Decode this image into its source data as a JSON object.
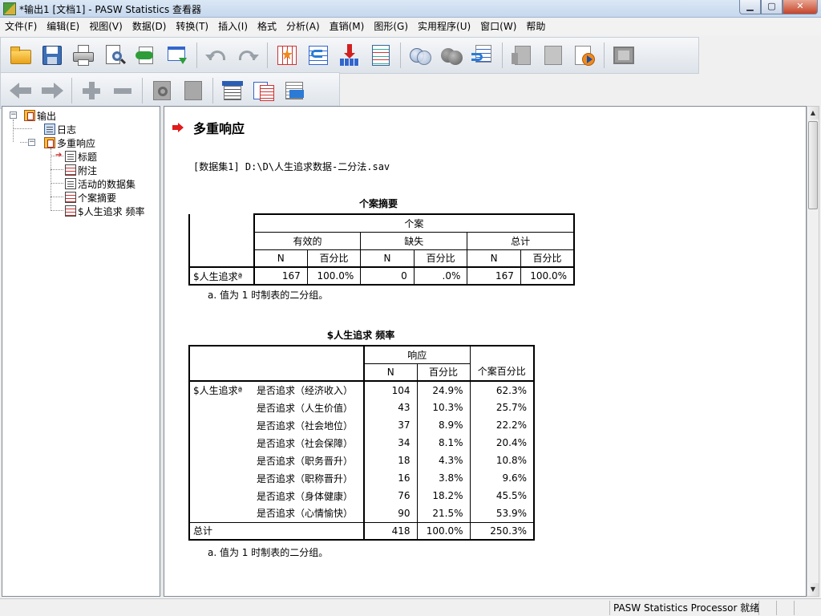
{
  "window": {
    "title": "*输出1 [文档1] - PASW Statistics 查看器",
    "min_label": "▁",
    "max_label": "▢",
    "close_label": "✕"
  },
  "menu": [
    {
      "label": "文件(F)"
    },
    {
      "label": "编辑(E)"
    },
    {
      "label": "视图(V)"
    },
    {
      "label": "数据(D)"
    },
    {
      "label": "转换(T)"
    },
    {
      "label": "插入(I)"
    },
    {
      "label": "格式"
    },
    {
      "label": "分析(A)"
    },
    {
      "label": "直销(M)"
    },
    {
      "label": "图形(G)"
    },
    {
      "label": "实用程序(U)"
    },
    {
      "label": "窗口(W)"
    },
    {
      "label": "帮助"
    }
  ],
  "tree": {
    "root": "输出",
    "log": "日志",
    "multi": "多重响应",
    "title": "标题",
    "notes": "附注",
    "active_dataset": "活动的数据集",
    "case_summary": "个案摘要",
    "freq": "$人生追求 频率"
  },
  "section": {
    "title": "多重响应",
    "dataset": "[数据集1] D:\\D\\人生追求数据-二分法.sav"
  },
  "case_summary_table": {
    "title": "个案摘要",
    "group_header": "个案",
    "sub_headers": [
      "有效的",
      "缺失",
      "总计"
    ],
    "col_headers": [
      "N",
      "百分比",
      "N",
      "百分比",
      "N",
      "百分比"
    ],
    "row_label": "$人生追求ª",
    "values": [
      "167",
      "100.0%",
      "0",
      ".0%",
      "167",
      "100.0%"
    ],
    "footnote": "a. 值为 1 时制表的二分组。"
  },
  "freq_table": {
    "title": "$人生追求 频率",
    "group_header": "响应",
    "col_headers": [
      "N",
      "百分比"
    ],
    "case_pct_header": "个案百分比",
    "var_label": "$人生追求ª",
    "rows": [
      {
        "label": "是否追求（经济收入）",
        "n": "104",
        "pct": "24.9%",
        "case": "62.3%"
      },
      {
        "label": "是否追求（人生价值）",
        "n": "43",
        "pct": "10.3%",
        "case": "25.7%"
      },
      {
        "label": "是否追求（社会地位）",
        "n": "37",
        "pct": "8.9%",
        "case": "22.2%"
      },
      {
        "label": "是否追求（社会保障）",
        "n": "34",
        "pct": "8.1%",
        "case": "20.4%"
      },
      {
        "label": "是否追求（职务晋升）",
        "n": "18",
        "pct": "4.3%",
        "case": "10.8%"
      },
      {
        "label": "是否追求（职称晋升）",
        "n": "16",
        "pct": "3.8%",
        "case": "9.6%"
      },
      {
        "label": "是否追求（身体健康）",
        "n": "76",
        "pct": "18.2%",
        "case": "45.5%"
      },
      {
        "label": "是否追求（心情愉快）",
        "n": "90",
        "pct": "21.5%",
        "case": "53.9%"
      }
    ],
    "total_label": "总计",
    "total": {
      "n": "418",
      "pct": "100.0%",
      "case": "250.3%"
    },
    "footnote": "a. 值为 1 时制表的二分组。"
  },
  "status": {
    "processor": "PASW Statistics Processor 就绪"
  }
}
